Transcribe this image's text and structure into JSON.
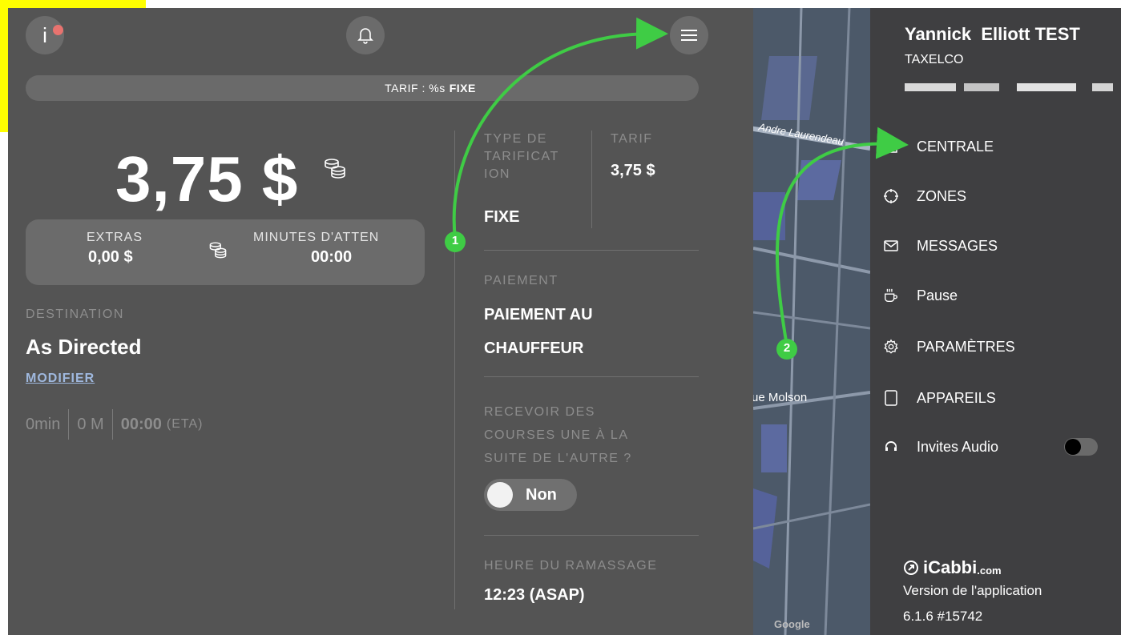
{
  "header": {
    "info_label": "i",
    "tarif_bar": {
      "prefix": "TARIF : %s",
      "suffix": "FIXE"
    }
  },
  "fare": {
    "amount": "3,75 $"
  },
  "extras": {
    "extras_label": "EXTRAS",
    "extras_value": "0,00 $",
    "wait_label": "MINUTES D'ATTEN",
    "wait_value": "00:00"
  },
  "destination": {
    "label": "DESTINATION",
    "value": "As Directed",
    "modify_link": "MODIFIER",
    "duration": "0min",
    "distance": "0 M",
    "eta_time": "00:00",
    "eta_label": "(ETA)"
  },
  "details": {
    "type_label_lines": [
      "TYPE DE",
      "TARIFICAT",
      "ION"
    ],
    "type_value": "FIXE",
    "tarif_label": "TARIF",
    "tarif_value": "3,75 $",
    "payment_label": "PAIEMENT",
    "payment_value_lines": [
      "PAIEMENT AU",
      "CHAUFFEUR"
    ],
    "consecutive_label_lines": [
      "RECEVOIR DES",
      "COURSES UNE À LA",
      "SUITE DE L'AUTRE ?"
    ],
    "consecutive_toggle": "Non",
    "pickup_label": "HEURE DU RAMASSAGE",
    "pickup_value": "12:23 (ASAP)"
  },
  "map": {
    "street1": "Andre Laurendeau",
    "street2": "ue Molson",
    "google_logo": "Google"
  },
  "drawer": {
    "user_name": "Yannick  Elliott TEST",
    "company": "TAXELCO",
    "menu": [
      {
        "label": "CENTRALE",
        "icon": "home-icon"
      },
      {
        "label": "ZONES",
        "icon": "target-icon"
      },
      {
        "label": "MESSAGES",
        "icon": "mail-icon"
      },
      {
        "label": "Pause",
        "icon": "coffee-cup-icon"
      },
      {
        "label": "PARAMÈTRES",
        "icon": "gear-icon"
      },
      {
        "label": "APPAREILS",
        "icon": "tablet-icon"
      },
      {
        "label": "Invites Audio",
        "icon": "headphones-icon"
      }
    ],
    "audio_toggle_on": false,
    "brand": "iCabbi",
    "brand_suffix": ".com",
    "version_label": "Version de l'application",
    "version_value": "6.1.6 #15742"
  },
  "annotations": {
    "step1": "1",
    "step2": "2",
    "color": "#3fcc45"
  },
  "colors": {
    "highlight": "#ffff00",
    "panel": "#545454",
    "drawer": "#3f3f41",
    "link": "#9fb8de",
    "notification": "#e8736f"
  }
}
